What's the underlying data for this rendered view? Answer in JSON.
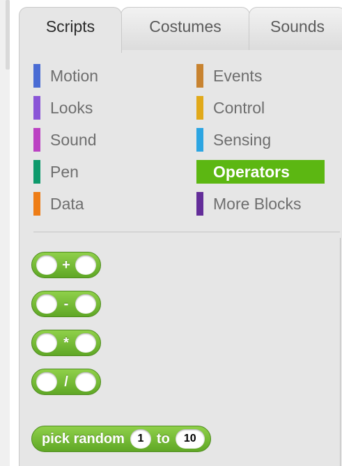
{
  "tabs": [
    {
      "label": "Scripts",
      "active": true
    },
    {
      "label": "Costumes",
      "active": false
    },
    {
      "label": "Sounds",
      "active": false
    }
  ],
  "categories": [
    {
      "label": "Motion",
      "color": "#4a6cd4"
    },
    {
      "label": "Looks",
      "color": "#8a55d7"
    },
    {
      "label": "Sound",
      "color": "#bb42c3"
    },
    {
      "label": "Pen",
      "color": "#0e9a6c"
    },
    {
      "label": "Data",
      "color": "#ee7d16"
    },
    {
      "label": "Events",
      "color": "#c88330"
    },
    {
      "label": "Control",
      "color": "#e1a91a"
    },
    {
      "label": "Sensing",
      "color": "#2ca5e2"
    },
    {
      "label": "Operators",
      "color": "#5cb712",
      "selected": true
    },
    {
      "label": "More Blocks",
      "color": "#632d99"
    }
  ],
  "blocks": {
    "add": {
      "op": "+"
    },
    "subtract": {
      "op": "-"
    },
    "multiply": {
      "op": "*"
    },
    "divide": {
      "op": "/"
    },
    "pick_random": {
      "label1": "pick random",
      "from": "1",
      "label2": "to",
      "to": "10"
    }
  },
  "colors": {
    "operators_block": "#5cb712",
    "palette_bg": "#e6e6e6"
  }
}
